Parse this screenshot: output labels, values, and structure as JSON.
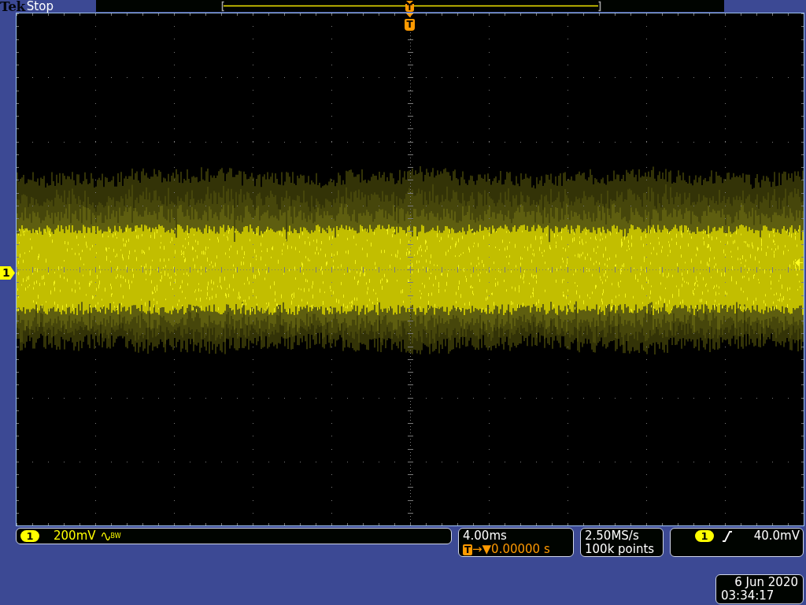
{
  "header": {
    "brand": "Tek",
    "acquisition_state": "Stop"
  },
  "record_view": {
    "trigger_marker": "T"
  },
  "graticule": {
    "trigger_marker": "T",
    "channel_marker": "1"
  },
  "channel": {
    "number": "1",
    "scale": "200mV",
    "bandwidth_limit": {
      "on": true,
      "label": "BW"
    }
  },
  "horizontal": {
    "scale": "4.00ms",
    "trigger_badge": "T",
    "delay": "→▼0.00000 s"
  },
  "acquisition": {
    "sample_rate": "2.50MS/s",
    "record_length": "100k points"
  },
  "trigger": {
    "source": "1",
    "slope": {
      "kind": "rising"
    },
    "level": "40.0mV"
  },
  "timestamp": {
    "date": "6 Jun 2020",
    "time": "03:34:17"
  }
}
